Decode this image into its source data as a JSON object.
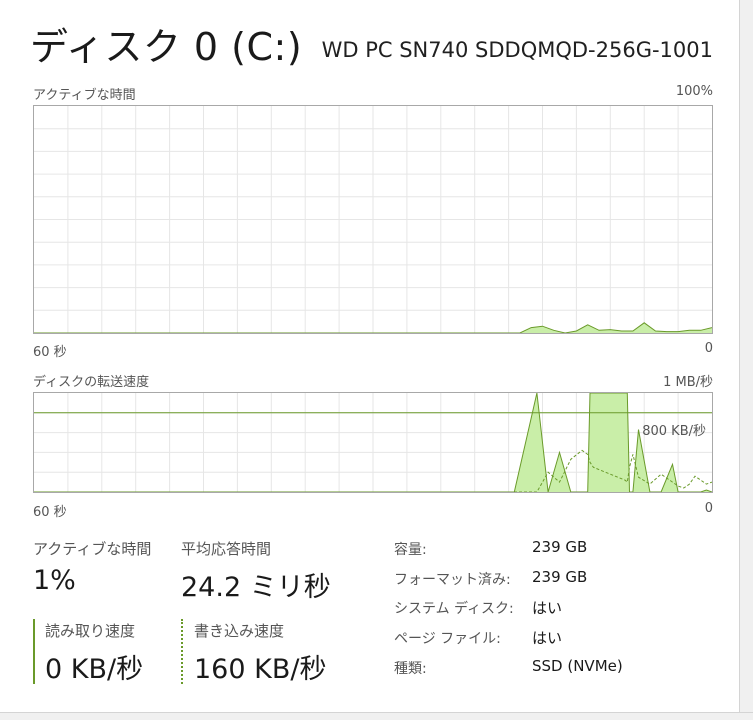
{
  "header": {
    "title": "ディスク 0 (C:)",
    "model": "WD PC SN740 SDDQMQD-256G-1001"
  },
  "active_chart": {
    "label": "アクティブな時間",
    "max_label": "100%",
    "left_bottom": "60 秒",
    "right_bottom": "0"
  },
  "transfer_chart": {
    "label": "ディスクの転送速度",
    "max_label": "1 MB/秒",
    "ref_label": "800 KB/秒",
    "left_bottom": "60 秒",
    "right_bottom": "0"
  },
  "stats": {
    "active_label": "アクティブな時間",
    "active_value": "1%",
    "response_label": "平均応答時間",
    "response_value": "24.2 ミリ秒",
    "read_label": "読み取り速度",
    "read_value": "0 KB/秒",
    "write_label": "書き込み速度",
    "write_value": "160 KB/秒"
  },
  "properties": [
    {
      "key": "容量:",
      "value": "239 GB"
    },
    {
      "key": "フォーマット済み:",
      "value": "239 GB"
    },
    {
      "key": "システム ディスク:",
      "value": "はい"
    },
    {
      "key": "ページ ファイル:",
      "value": "はい"
    },
    {
      "key": "種類:",
      "value": "SSD (NVMe)"
    }
  ],
  "colors": {
    "line": "#6a9a2a",
    "fill": "#c9eea8",
    "grid": "#e6e6e6",
    "border": "#a8a8a8"
  },
  "chart_data": [
    {
      "type": "area",
      "title": "アクティブな時間",
      "xlabel": "",
      "ylabel": "",
      "x": [
        60,
        57,
        54,
        51,
        48,
        45,
        42,
        39,
        36,
        33,
        30,
        27,
        24,
        21,
        18,
        15,
        12,
        9,
        6,
        3,
        0
      ],
      "series": [
        {
          "values": [
            0,
            0,
            0,
            0,
            0,
            0,
            0,
            0,
            0,
            0,
            0,
            0,
            0,
            0,
            0,
            0,
            0,
            0,
            0,
            0,
            0
          ]
        }
      ],
      "ylim": [
        0,
        100
      ],
      "grid": true
    },
    {
      "type": "area",
      "title": "ディスクの転送速度",
      "xlabel": "",
      "ylabel": "",
      "x_seconds_ago": [
        60,
        17.5,
        15.5,
        14.5,
        13.5,
        12.5,
        11.5,
        11,
        10.8,
        10.5,
        7.7,
        7.5,
        7.3,
        7,
        6.5,
        5.5,
        5,
        4.5,
        3.5,
        3,
        2.5,
        2,
        1.5,
        1,
        0.5,
        0
      ],
      "series": [
        {
          "values_kbps": [
            0,
            0,
            1200,
            0,
            400,
            0,
            0,
            0,
            1200,
            1200,
            1200,
            1200,
            0,
            0,
            630,
            0,
            0,
            0,
            280,
            0,
            0,
            0,
            0,
            0,
            20,
            0
          ],
          "style": "solid-fill"
        },
        {
          "values_kbps": [
            0,
            0,
            0,
            200,
            100,
            330,
            420,
            380,
            300,
            250,
            120,
            100,
            250,
            380,
            150,
            80,
            130,
            180,
            100,
            60,
            40,
            80,
            160,
            120,
            80,
            100
          ],
          "style": "dashed"
        }
      ],
      "ylim_kbps": [
        0,
        1000
      ],
      "reference_lines_kbps": [
        800
      ],
      "grid": true
    }
  ]
}
